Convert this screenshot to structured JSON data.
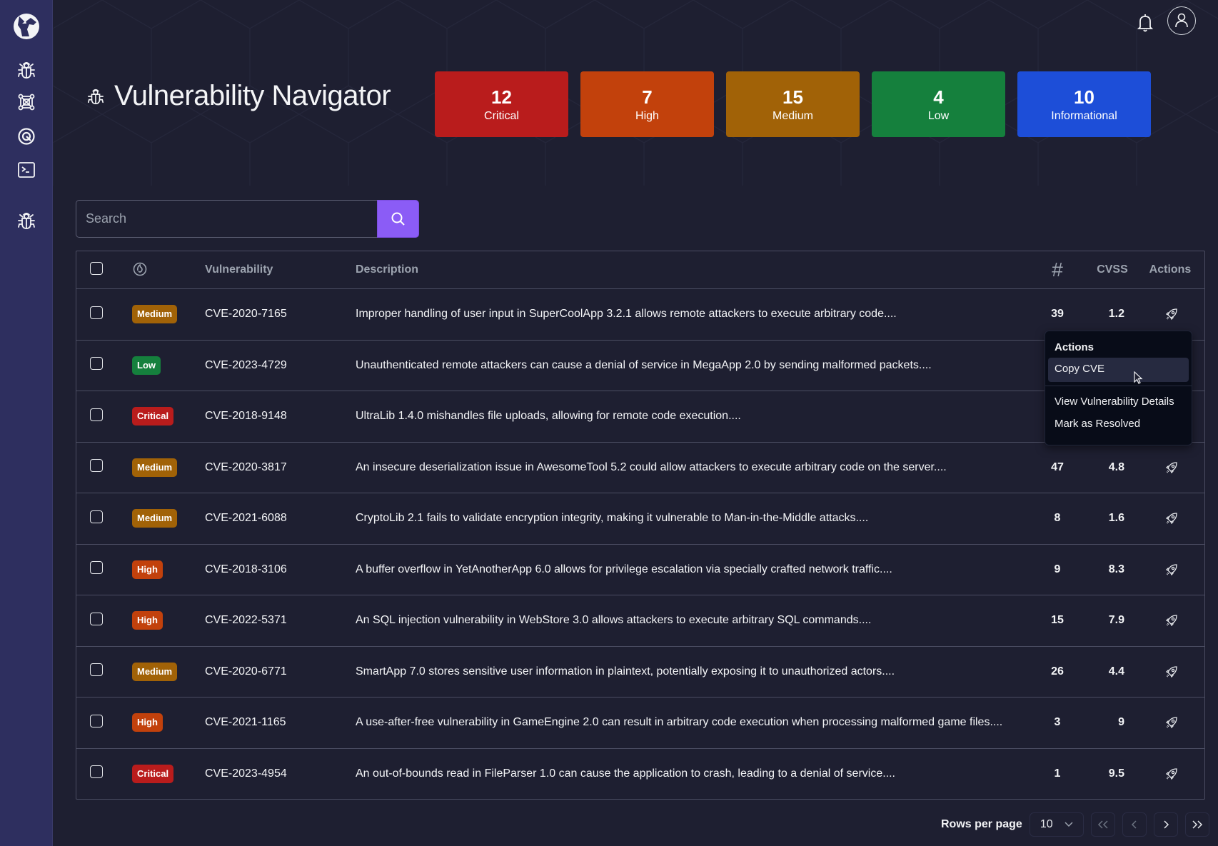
{
  "app": {
    "title": "Vulnerability Navigator"
  },
  "sidebar": {
    "items": [
      {
        "icon": "bug-icon",
        "label": "Vulnerabilities"
      },
      {
        "icon": "network-icon",
        "label": "Network"
      },
      {
        "icon": "target-icon",
        "label": "Targets"
      },
      {
        "icon": "terminal-icon",
        "label": "Terminal"
      },
      {
        "icon": "bug-icon",
        "label": "Bugs"
      }
    ]
  },
  "stats": [
    {
      "count": "12",
      "label": "Critical",
      "color": "#b91c1c"
    },
    {
      "count": "7",
      "label": "High",
      "color": "#c2410c"
    },
    {
      "count": "15",
      "label": "Medium",
      "color": "#a16207"
    },
    {
      "count": "4",
      "label": "Low",
      "color": "#15803d"
    },
    {
      "count": "10",
      "label": "Informational",
      "color": "#1d4ed8"
    }
  ],
  "search": {
    "placeholder": "Search",
    "value": ""
  },
  "table": {
    "headers": {
      "vulnerability": "Vulnerability",
      "description": "Description",
      "count": "#",
      "cvss": "CVSS",
      "actions": "Actions"
    },
    "rows": [
      {
        "severity": "Medium",
        "cve": "CVE-2020-7165",
        "description": "Improper handling of user input in SuperCoolApp 3.2.1 allows remote attackers to execute arbitrary code....",
        "count": "39",
        "cvss": "1.2"
      },
      {
        "severity": "Low",
        "cve": "CVE-2023-4729",
        "description": "Unauthenticated remote attackers can cause a denial of service in MegaApp 2.0 by sending malformed packets....",
        "count": "",
        "cvss": ""
      },
      {
        "severity": "Critical",
        "cve": "CVE-2018-9148",
        "description": "UltraLib 1.4.0 mishandles file uploads, allowing for remote code execution....",
        "count": "",
        "cvss": ""
      },
      {
        "severity": "Medium",
        "cve": "CVE-2020-3817",
        "description": "An insecure deserialization issue in AwesomeTool 5.2 could allow attackers to execute arbitrary code on the server....",
        "count": "47",
        "cvss": "4.8"
      },
      {
        "severity": "Medium",
        "cve": "CVE-2021-6088",
        "description": "CryptoLib 2.1 fails to validate encryption integrity, making it vulnerable to Man-in-the-Middle attacks....",
        "count": "8",
        "cvss": "1.6"
      },
      {
        "severity": "High",
        "cve": "CVE-2018-3106",
        "description": "A buffer overflow in YetAnotherApp 6.0 allows for privilege escalation via specially crafted network traffic....",
        "count": "9",
        "cvss": "8.3"
      },
      {
        "severity": "High",
        "cve": "CVE-2022-5371",
        "description": "An SQL injection vulnerability in WebStore 3.0 allows attackers to execute arbitrary SQL commands....",
        "count": "15",
        "cvss": "7.9"
      },
      {
        "severity": "Medium",
        "cve": "CVE-2020-6771",
        "description": "SmartApp 7.0 stores sensitive user information in plaintext, potentially exposing it to unauthorized actors....",
        "count": "26",
        "cvss": "4.4"
      },
      {
        "severity": "High",
        "cve": "CVE-2021-1165",
        "description": "A use-after-free vulnerability in GameEngine 2.0 can result in arbitrary code execution when processing malformed game files....",
        "count": "3",
        "cvss": "9"
      },
      {
        "severity": "Critical",
        "cve": "CVE-2023-4954",
        "description": "An out-of-bounds read in FileParser 1.0 can cause the application to crash, leading to a denial of service....",
        "count": "1",
        "cvss": "9.5"
      }
    ]
  },
  "severity_colors": {
    "Critical": "#b91c1c",
    "High": "#c2410c",
    "Medium": "#a16207",
    "Low": "#15803d",
    "Informational": "#1d4ed8"
  },
  "actions_menu": {
    "title": "Actions",
    "items": [
      {
        "label": "Copy CVE",
        "highlighted": true
      },
      {
        "label": "View Vulnerability Details",
        "highlighted": false
      },
      {
        "label": "Mark as Resolved",
        "highlighted": false
      }
    ]
  },
  "pagination": {
    "rows_per_page_label": "Rows per page",
    "rows_per_page": "10"
  },
  "colors": {
    "accent": "#8b5cf6",
    "background": "#1e1f31",
    "sidebar": "#2e2f5f"
  }
}
